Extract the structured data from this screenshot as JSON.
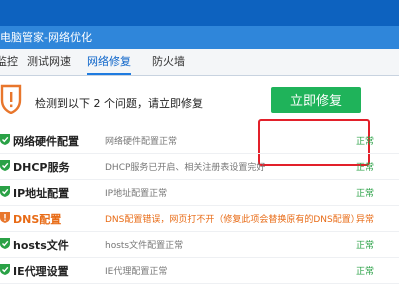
{
  "window": {
    "title": "电脑管家-网络优化"
  },
  "tabs": [
    {
      "label": "监控"
    },
    {
      "label": "测试网速"
    },
    {
      "label": "网络修复"
    },
    {
      "label": "防火墙"
    }
  ],
  "banner": {
    "message": "检测到以下 2 个问题，请立即修复",
    "fix_button": "立即修复",
    "warning_color": "#e8762c",
    "fix_color": "#1fb35a"
  },
  "items": [
    {
      "name": "网络硬件配置",
      "desc": "网络硬件配置正常",
      "status": "正常",
      "state": "ok"
    },
    {
      "name": "DHCP服务",
      "desc": "DHCP服务已开启、相关注册表设置完好",
      "status": "正常",
      "state": "ok"
    },
    {
      "name": "IP地址配置",
      "desc": "IP地址配置正常",
      "status": "正常",
      "state": "ok"
    },
    {
      "name": "DNS配置",
      "desc": "DNS配置错误，网页打不开（修复此项会替换原有的DNS配置）",
      "status": "异常",
      "state": "bad"
    },
    {
      "name": "hosts文件",
      "desc": "hosts文件配置正常",
      "status": "正常",
      "state": "ok"
    },
    {
      "name": "IE代理设置",
      "desc": "IE代理配置正常",
      "status": "正常",
      "state": "ok"
    }
  ]
}
